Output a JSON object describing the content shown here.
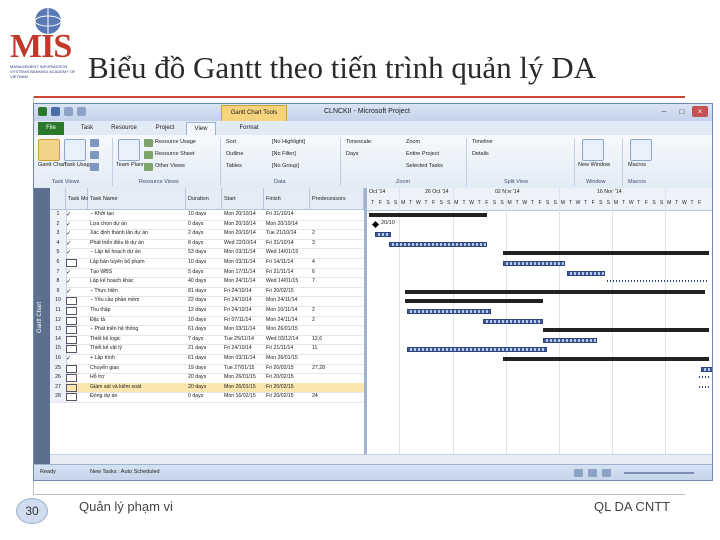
{
  "slide": {
    "title": "Biểu đồ Gantt theo tiến trình quản lý DA",
    "page_number": "30",
    "footer_left": "Quản lý phạm vi",
    "footer_right": "QL DA CNTT",
    "logo_text": "MIS",
    "logo_subtext": "MANAGEMENT INFORMATION SYSTEMS BANKING ACADEMY OF VIETNAM"
  },
  "app": {
    "context_tab": "Gantt Chart Tools",
    "window_title": "CLNCKII - Microsoft Project",
    "tabs": [
      "File",
      "Task",
      "Resource",
      "Project",
      "View",
      "Format"
    ],
    "active_tab": "View",
    "ribbon": {
      "task_views": {
        "label": "Task Views",
        "gantt_label": "Gantt Chart",
        "usage_label": "Task Usage"
      },
      "resource_views": {
        "label": "Resource Views",
        "items": [
          "Resource Usage",
          "Resource Sheet",
          "Other Views"
        ],
        "team_planner": "Team Planner"
      },
      "data": {
        "label": "Data",
        "sort": "Sort",
        "outline": "Outline",
        "tables": "Tables",
        "highlight": "[No Highlight]",
        "filter": "[No Filter]",
        "group": "[No Group]"
      },
      "zoom": {
        "label": "Zoom",
        "timescale_label": "Timescale:",
        "timescale_value": "Days",
        "zoom": "Zoom",
        "entire_project": "Entire Project",
        "selected_tasks": "Selected Tasks"
      },
      "split_view": {
        "label": "Split View",
        "timeline": "Timeline",
        "details": "Details"
      },
      "window": {
        "label": "Window",
        "new_window": "New Window"
      },
      "macros": {
        "label": "Macros",
        "macros_btn": "Macros"
      }
    },
    "sidebar_label": "Gantt Chart",
    "grid": {
      "headers": [
        "",
        "Task Mode",
        "Task Name",
        "Duration",
        "Start",
        "Finish",
        "Predecessors"
      ],
      "rows": [
        {
          "id": "1",
          "mode": "auto",
          "name": "− Khởi tạo",
          "duration": "10 days",
          "start": "Mon 20/10/14",
          "finish": "Fri 31/10/14",
          "pred": ""
        },
        {
          "id": "2",
          "mode": "auto",
          "name": "Lựa chọn dự án",
          "duration": "0 days",
          "start": "Mon 20/10/14",
          "finish": "Mon 20/10/14",
          "pred": ""
        },
        {
          "id": "3",
          "mode": "auto",
          "name": "Xác định thành lân dự án",
          "duration": "2 days",
          "start": "Mon 20/10/14",
          "finish": "Tue 21/10/14",
          "pred": "2"
        },
        {
          "id": "4",
          "mode": "auto",
          "name": "Phát triển điều lệ dự án",
          "duration": "8 days",
          "start": "Wed 22/10/14",
          "finish": "Fri 31/10/14",
          "pred": "3"
        },
        {
          "id": "5",
          "mode": "auto",
          "name": "− Lập kế hoạch dự án",
          "duration": "53 days",
          "start": "Mon 03/11/14",
          "finish": "Wed 14/01/15",
          "pred": ""
        },
        {
          "id": "6",
          "mode": "manual",
          "name": "Lập bản tuyên bố phạm",
          "duration": "10 days",
          "start": "Mon 03/11/14",
          "finish": "Fri 14/11/14",
          "pred": "4"
        },
        {
          "id": "7",
          "mode": "auto",
          "name": "Tạo WBS",
          "duration": "5 days",
          "start": "Mon 17/11/14",
          "finish": "Fri 21/11/14",
          "pred": "6"
        },
        {
          "id": "8",
          "mode": "auto",
          "name": "Lập kế hoạch khác",
          "duration": "40 days",
          "start": "Mon 24/11/14",
          "finish": "Wed 14/01/15",
          "pred": "7"
        },
        {
          "id": "9",
          "mode": "auto",
          "name": "− Thực hiện",
          "duration": "81 days",
          "start": "Fri 24/10/14",
          "finish": "Fri 20/02/15",
          "pred": ""
        },
        {
          "id": "10",
          "mode": "manual",
          "name": "− Yêu cầu phần mềm",
          "duration": "22 days",
          "start": "Fri 24/10/14",
          "finish": "Mon 24/11/14",
          "pred": ""
        },
        {
          "id": "11",
          "mode": "manual",
          "name": "Thu thập",
          "duration": "12 days",
          "start": "Fri 24/10/14",
          "finish": "Mon 10/11/14",
          "pred": "2"
        },
        {
          "id": "12",
          "mode": "manual",
          "name": "Đặc tả",
          "duration": "10 days",
          "start": "Fri 07/11/14",
          "finish": "Mon 24/11/14",
          "pred": "2"
        },
        {
          "id": "13",
          "mode": "manual",
          "name": "− Phát triển hệ thống",
          "duration": "61 days",
          "start": "Mon 03/11/14",
          "finish": "Mon 26/01/15",
          "pred": ""
        },
        {
          "id": "14",
          "mode": "manual",
          "name": "Thiết kế logic",
          "duration": "7 days",
          "start": "Tue 25/11/14",
          "finish": "Wed 03/12/14",
          "pred": "12,6"
        },
        {
          "id": "15",
          "mode": "manual",
          "name": "Thiết kế vật lý",
          "duration": "21 days",
          "start": "Fri 24/10/14",
          "finish": "Fri 21/11/14",
          "pred": "11"
        },
        {
          "id": "16",
          "mode": "auto",
          "name": "+ Lập trình",
          "duration": "61 days",
          "start": "Mon 03/11/14",
          "finish": "Mon 26/01/15",
          "pred": ""
        },
        {
          "id": "25",
          "mode": "manual",
          "name": "Chuyển giao",
          "duration": "19 days",
          "start": "Tue 27/01/15",
          "finish": "Fri 20/02/15",
          "pred": "27,28"
        },
        {
          "id": "26",
          "mode": "manual",
          "name": "Hỗ trợ",
          "duration": "20 days",
          "start": "Mon 26/01/15",
          "finish": "Fri 20/02/15",
          "pred": ""
        },
        {
          "id": "27",
          "mode": "manual",
          "name": "Giám sát và kiểm soát",
          "duration": "20 days",
          "start": "Mon 26/01/15",
          "finish": "Fri 20/02/15",
          "pred": ""
        },
        {
          "id": "28",
          "mode": "manual",
          "name": "Đóng dự án",
          "duration": "0 days",
          "start": "Mon 16/02/15",
          "finish": "Fri 20/02/15",
          "pred": "24"
        }
      ]
    },
    "timescale": {
      "weeks": [
        "Oct '14",
        "26 Oct '14",
        "02 Nov '14",
        "16 Nov '14"
      ],
      "days": [
        "T",
        "F",
        "S",
        "S",
        "M",
        "T",
        "W",
        "T",
        "F",
        "S",
        "S",
        "M",
        "T",
        "W",
        "T",
        "F",
        "S",
        "S",
        "M",
        "T",
        "W",
        "T",
        "F",
        "S",
        "S",
        "M",
        "T",
        "W",
        "T",
        "F",
        "S",
        "S",
        "M",
        "T",
        "W",
        "T",
        "F",
        "S",
        "S",
        "M",
        "T",
        "W",
        "T",
        "F"
      ]
    },
    "milestone_label": "20/10",
    "status": {
      "ready": "Ready",
      "new_tasks": "New Tasks : Auto Scheduled"
    }
  }
}
